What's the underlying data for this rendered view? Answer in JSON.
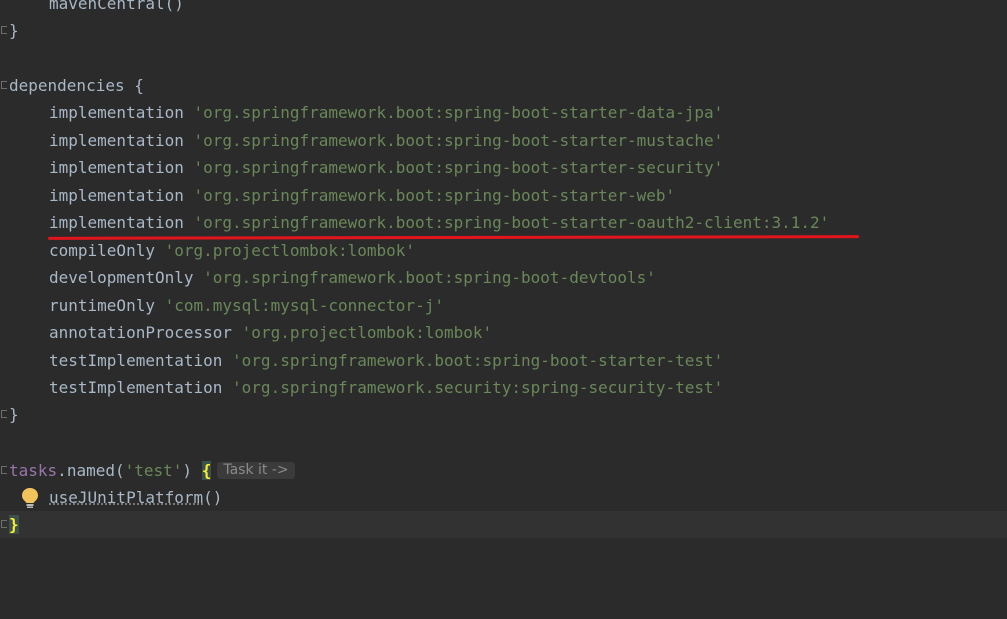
{
  "lines": [
    {
      "text": "mavenCentral()"
    },
    {
      "text": "}"
    },
    {
      "text": ""
    },
    {
      "keyword": "dependencies",
      "brace": " {"
    },
    {
      "method": "implementation",
      "value": "'org.springframework.boot:spring-boot-starter-data-jpa'"
    },
    {
      "method": "implementation",
      "value": "'org.springframework.boot:spring-boot-starter-mustache'"
    },
    {
      "method": "implementation",
      "value": "'org.springframework.boot:spring-boot-starter-security'"
    },
    {
      "method": "implementation",
      "value": "'org.springframework.boot:spring-boot-starter-web'"
    },
    {
      "method": "implementation",
      "value": "'org.springframework.boot:spring-boot-starter-oauth2-client:3.1.2'"
    },
    {
      "method": "compileOnly",
      "value": "'org.projectlombok:lombok'"
    },
    {
      "method": "developmentOnly",
      "value": "'org.springframework.boot:spring-boot-devtools'"
    },
    {
      "method": "runtimeOnly",
      "value": "'com.mysql:mysql-connector-j'"
    },
    {
      "method": "annotationProcessor",
      "value": "'org.projectlombok:lombok'"
    },
    {
      "method": "testImplementation",
      "value": "'org.springframework.boot:spring-boot-starter-test'"
    },
    {
      "method": "testImplementation",
      "value": "'org.springframework.security:spring-security-test'"
    },
    {
      "text": "}"
    },
    {
      "text": ""
    },
    {
      "obj": "tasks",
      "dot": ".",
      "call": "named",
      "open": "(",
      "arg": "'test'",
      "close": ")",
      "space": " ",
      "brace": "{",
      "hint": "Task it ->"
    },
    {
      "call": "useJUnitPlatform",
      "parens": "()"
    },
    {
      "text": "}"
    }
  ],
  "colors": {
    "background": "#2b2b2b",
    "text": "#a9b7c6",
    "string": "#6a8759",
    "keyword_method": "#cc7832",
    "highlight_brace": "#ffef28",
    "annotation_underline": "#e3141b"
  },
  "icons": {
    "fold": "fold-marker-icon",
    "intention": "lightbulb-icon"
  }
}
